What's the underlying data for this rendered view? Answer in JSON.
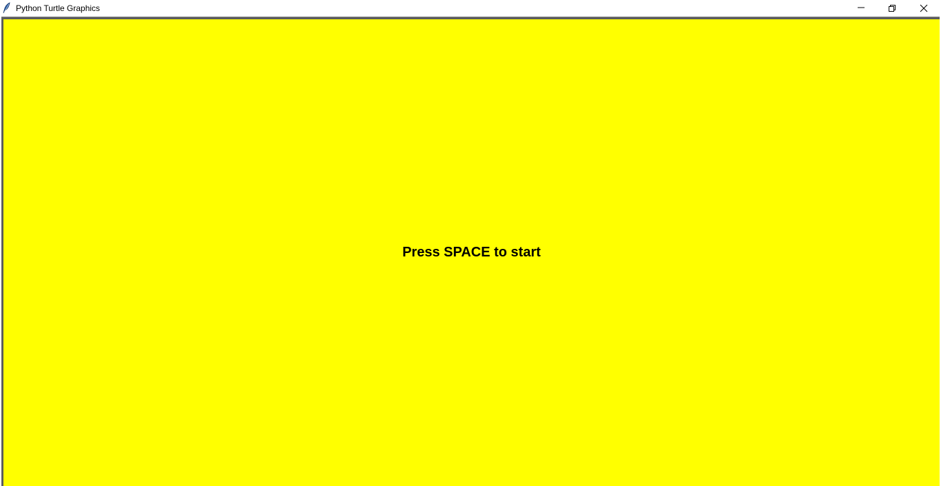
{
  "window": {
    "title": "Python Turtle Graphics",
    "icon": "feather-icon",
    "controls": {
      "minimize_icon": "minimize-icon",
      "restore_icon": "restore-icon",
      "close_icon": "close-icon"
    }
  },
  "canvas": {
    "background_color": "#ffff00",
    "message": "Press SPACE to start",
    "message_color": "#000000"
  }
}
